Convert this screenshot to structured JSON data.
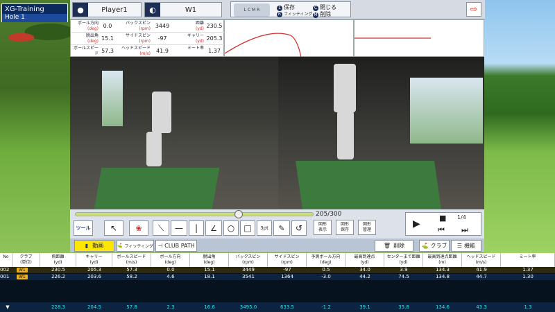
{
  "app": {
    "title": "XG-Training",
    "hole": "Hole 1"
  },
  "header": {
    "player": "Player1",
    "club": "W1",
    "exit_icon": "exit-icon"
  },
  "menu": {
    "logo": "L C M R",
    "save_key": "L",
    "save": "保存",
    "close_key": "C",
    "close": "閉じる",
    "fit_key": "R",
    "fitting": "フィッティング",
    "del_key": "M",
    "delete": "削除"
  },
  "stats": [
    {
      "k1": "ボール方向",
      "u1": "(deg)",
      "v1": "0.0",
      "k2": "バックスピン",
      "u2": "(rpm)",
      "v2": "3449",
      "k3": "距離",
      "u3": "(yd)",
      "v3": "230.5"
    },
    {
      "k1": "脱出角",
      "u1": "(deg)",
      "v1": "15.1",
      "k2": "サイドスピン",
      "u2": "(rpm)",
      "v2": "-97",
      "k3": "キャリー",
      "u3": "(yd)",
      "v3": "205.3"
    },
    {
      "k1": "ボールスピード",
      "u1": "(m/s)",
      "v1": "57.3",
      "k2": "ヘッドスピード",
      "u2": "(m/s)",
      "v2": "41.9",
      "k3": "ミート率",
      "u3": "",
      "v3": "1.37"
    }
  ],
  "player": {
    "frame": "205/300",
    "progress": 0.683,
    "page": "1/4"
  },
  "tools": {
    "tool": "ツール",
    "width": "3pt",
    "fig_show": "図形\n表示",
    "fig_save": "図形\n保存",
    "fig_manage": "図形\n管理"
  },
  "bottom": {
    "video": "動画",
    "fitting": "フィッティング",
    "clubpath": "CLUB PATH",
    "delete": "削除",
    "club": "クラブ",
    "func": "機能"
  },
  "colors": {
    "accent": "#1e2f56",
    "highlight": "#ffe600",
    "cyan": "#2ee0f0"
  },
  "table": {
    "headers": [
      "No",
      "クラブ\n(単位)",
      "飛距離\n(yd)",
      "キャリー\n(yd)",
      "ボールスピード\n(m/s)",
      "ボール方向\n(deg)",
      "脱出角\n(deg)",
      "バックスピン\n(rpm)",
      "サイドスピン\n(rpm)",
      "予測ボール方向\n(deg)",
      "最高到達点\n(yd)",
      "センターまで距離\n(yd)",
      "最高到達点距離\n(m)",
      "ヘッドスピード\n(m/s)",
      "ミート率"
    ],
    "rows": [
      [
        "002",
        "W1",
        "230.5",
        "205.3",
        "57.3",
        "0.0",
        "15.1",
        "3449",
        "-97",
        "0.5",
        "34.0",
        "3.9",
        "134.3",
        "41.9",
        "1.37"
      ],
      [
        "001",
        "W1",
        "226.2",
        "203.6",
        "58.2",
        "4.6",
        "18.1",
        "3541",
        "1364",
        "-3.0",
        "44.2",
        "74.5",
        "134.8",
        "44.7",
        "1.30"
      ]
    ],
    "summary": [
      "228.3",
      "204.5",
      "57.8",
      "2.3",
      "16.6",
      "3495.0",
      "633.5",
      "-1.2",
      "39.1",
      "35.8",
      "134.6",
      "43.3",
      "1.3"
    ]
  }
}
